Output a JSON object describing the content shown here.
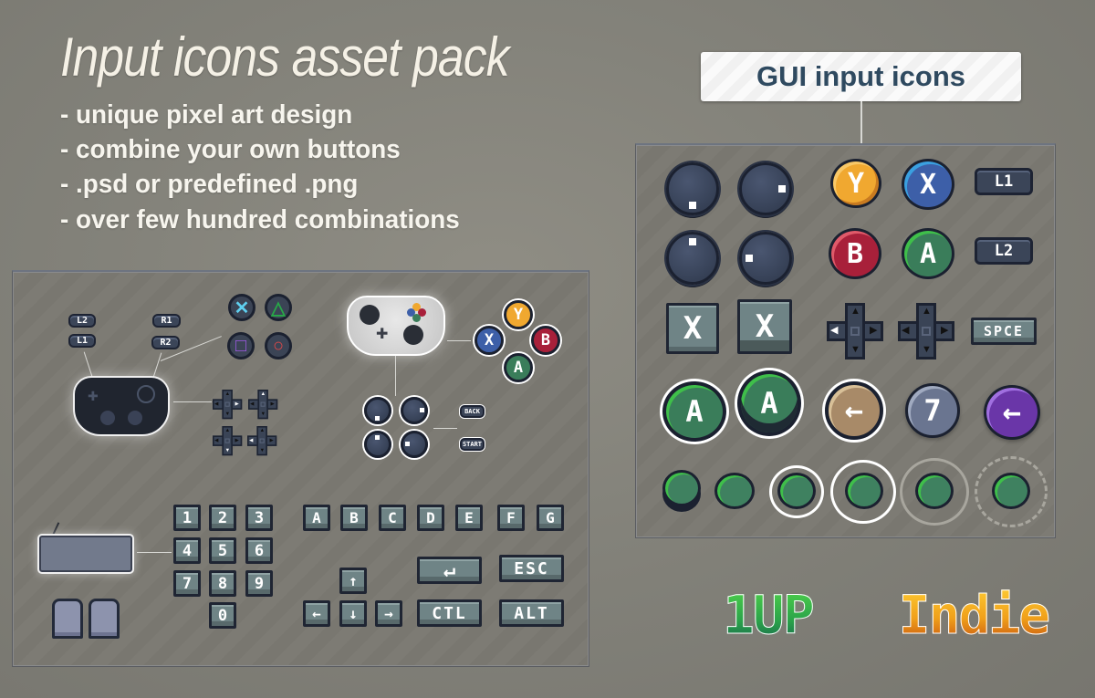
{
  "header": {
    "title": "Input icons asset pack",
    "features": [
      "- unique pixel art design",
      "- combine your own buttons",
      "- .psd or predefined .png",
      "- over few hundred combinations"
    ]
  },
  "gui_panel": {
    "label": "GUI input icons",
    "row1": {
      "sticks": [
        "stick-down",
        "stick-right"
      ],
      "face_buttons": [
        {
          "letter": "Y",
          "color": "#f0a830"
        },
        {
          "letter": "X",
          "color": "#3d5fa8"
        }
      ],
      "trigger": "L1"
    },
    "row2": {
      "sticks": [
        "stick-up",
        "stick-left"
      ],
      "face_buttons": [
        {
          "letter": "B",
          "color": "#a8203a"
        },
        {
          "letter": "A",
          "color": "#3a7d5a"
        }
      ],
      "trigger": "L2"
    },
    "row3": {
      "keys": [
        "X",
        "X"
      ],
      "dpads": [
        "dpad-left",
        "dpad-plain"
      ],
      "space_key": "SPCE"
    },
    "row4": [
      {
        "label": "A",
        "color": "#3a7d5a",
        "variant": "outlined"
      },
      {
        "label": "A",
        "color": "#3a7d5a",
        "variant": "raised-outlined"
      },
      {
        "label": "←",
        "color": "#a88a68",
        "variant": "outlined"
      },
      {
        "label": "7",
        "color": "#6a7590",
        "variant": "plain"
      },
      {
        "label": "←",
        "color": "#6a36a8",
        "variant": "plain"
      }
    ],
    "row5_states": [
      "raised",
      "flat",
      "ring-small",
      "ring-large",
      "ring-faded",
      "ring-dashed"
    ]
  },
  "ps_section": {
    "triggers_left": [
      "L2",
      "L1"
    ],
    "triggers_right": [
      "R1",
      "R2"
    ],
    "shape_buttons": [
      {
        "symbol": "✕",
        "color": "#5fd0f0"
      },
      {
        "symbol": "△",
        "color": "#28a848"
      },
      {
        "symbol": "□",
        "color": "#a05ae8"
      },
      {
        "symbol": "○",
        "color": "#e04848"
      }
    ],
    "dpads": [
      "dpad-right",
      "dpad-up",
      "dpad-down",
      "dpad-left"
    ]
  },
  "xbox_section": {
    "face_buttons": [
      {
        "letter": "Y",
        "color": "#f0a830"
      },
      {
        "letter": "X",
        "color": "#3d5fa8"
      },
      {
        "letter": "B",
        "color": "#a8203a"
      },
      {
        "letter": "A",
        "color": "#3a7d5a"
      }
    ],
    "sticks": [
      "stick-down",
      "stick-right",
      "stick-up",
      "stick-left"
    ],
    "menu_buttons": [
      "BACK",
      "START"
    ]
  },
  "keyboard_section": {
    "numpad": [
      "1",
      "2",
      "3",
      "4",
      "5",
      "6",
      "7",
      "8",
      "9",
      "0"
    ],
    "letters": [
      "A",
      "B",
      "C",
      "D",
      "E",
      "F",
      "G"
    ],
    "arrows": [
      "↑",
      "←",
      "↓",
      "→"
    ],
    "special_keys": [
      "ESC",
      "CTL",
      "ALT"
    ],
    "enter_glyph": "↵"
  },
  "logo": {
    "part1": "1UP",
    "part2": "Indie"
  }
}
